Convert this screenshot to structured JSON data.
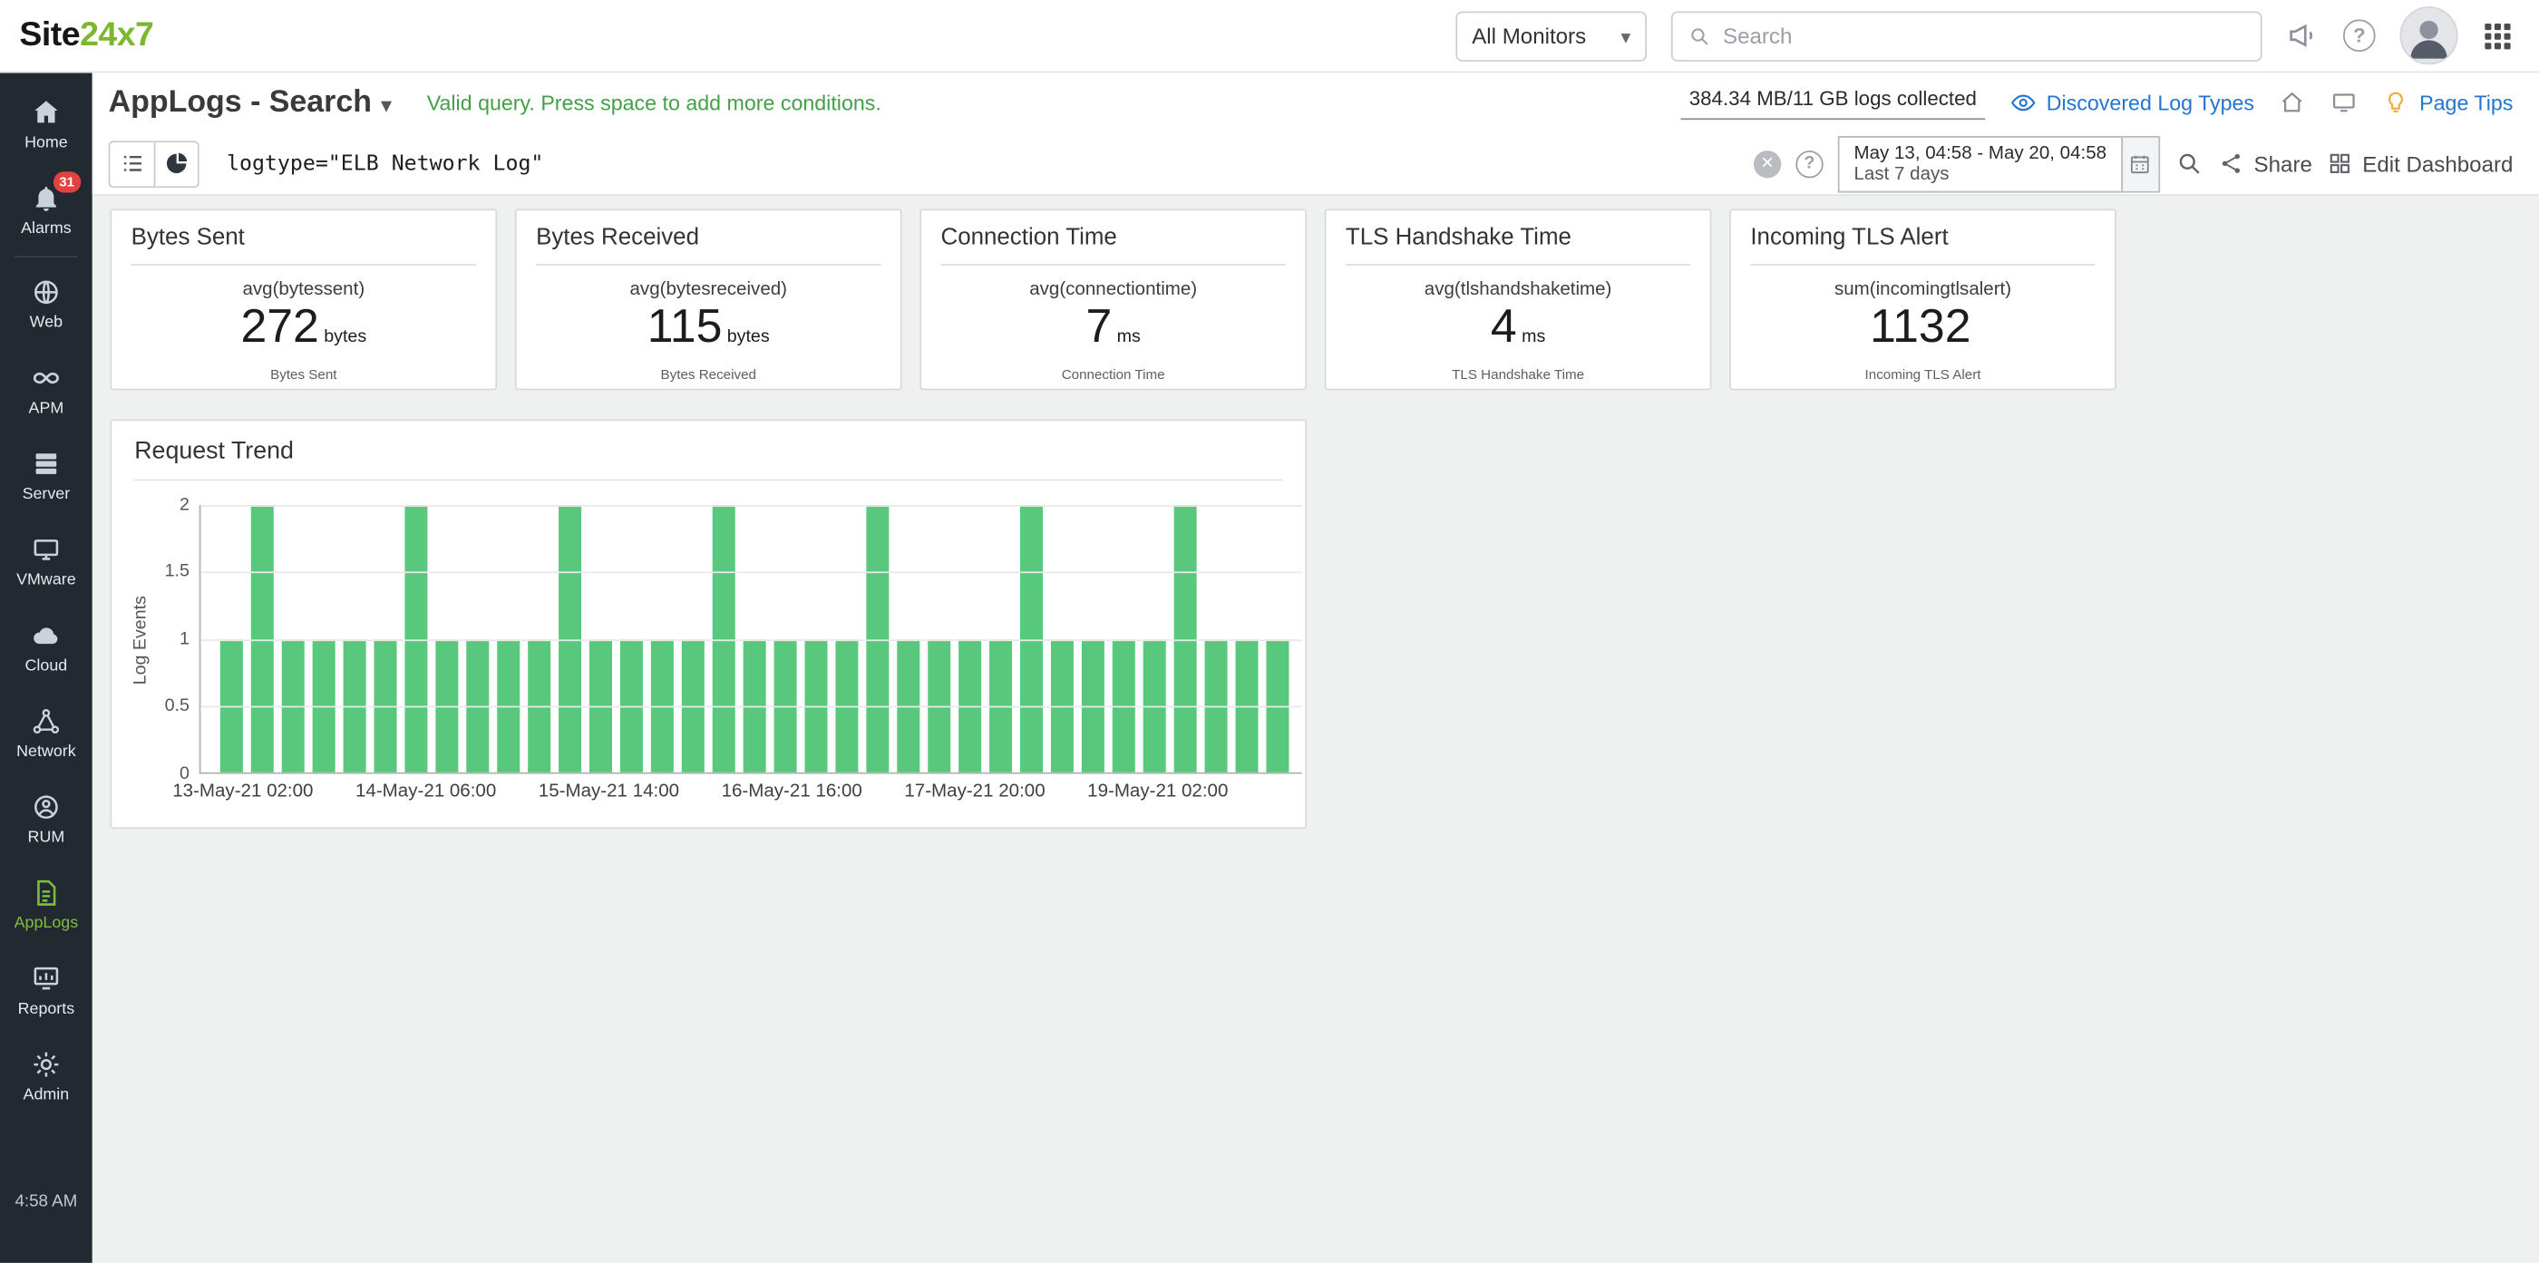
{
  "topbar": {
    "logo_site": "Site",
    "logo_24x7": "24x7",
    "monitor_select": "All Monitors",
    "search_placeholder": "Search"
  },
  "sidebar": {
    "items": [
      {
        "label": "Home"
      },
      {
        "label": "Alarms",
        "badge": "31"
      },
      {
        "label": "Web"
      },
      {
        "label": "APM"
      },
      {
        "label": "Server"
      },
      {
        "label": "VMware"
      },
      {
        "label": "Cloud"
      },
      {
        "label": "Network"
      },
      {
        "label": "RUM"
      },
      {
        "label": "AppLogs",
        "active": true
      },
      {
        "label": "Reports"
      },
      {
        "label": "Admin"
      }
    ],
    "time": "4:58 AM"
  },
  "header": {
    "title": "AppLogs - Search",
    "query_status": "Valid query. Press space to add more conditions.",
    "usage": "384.34 MB/11 GB logs collected",
    "discovered_link": "Discovered Log Types",
    "page_tips": "Page Tips"
  },
  "querybar": {
    "query": "logtype=\"ELB Network Log\"",
    "date_range": "May 13, 04:58 - May 20, 04:58",
    "date_preset": "Last 7 days",
    "share": "Share",
    "edit_dashboard": "Edit Dashboard"
  },
  "cards": [
    {
      "title": "Bytes Sent",
      "agg": "avg(bytessent)",
      "value": "272",
      "unit": "bytes",
      "footer": "Bytes Sent"
    },
    {
      "title": "Bytes Received",
      "agg": "avg(bytesreceived)",
      "value": "115",
      "unit": "bytes",
      "footer": "Bytes Received"
    },
    {
      "title": "Connection Time",
      "agg": "avg(connectiontime)",
      "value": "7",
      "unit": "ms",
      "footer": "Connection Time"
    },
    {
      "title": "TLS Handshake Time",
      "agg": "avg(tlshandshaketime)",
      "value": "4",
      "unit": "ms",
      "footer": "TLS Handshake Time"
    },
    {
      "title": "Incoming TLS Alert",
      "agg": "sum(incomingtlsalert)",
      "value": "1132",
      "unit": "",
      "footer": "Incoming TLS Alert"
    }
  ],
  "chart_data": {
    "type": "bar",
    "title": "Request Trend",
    "ylabel": "Log Events",
    "ylim": [
      0,
      2
    ],
    "yticks": [
      0,
      0.5,
      1,
      1.5,
      2
    ],
    "grid": true,
    "bar_color": "#58c87d",
    "x_tick_labels": [
      "13-May-21 02:00",
      "14-May-21 06:00",
      "15-May-21 14:00",
      "16-May-21 16:00",
      "17-May-21 20:00",
      "19-May-21 02:00"
    ],
    "values": [
      1,
      2,
      1,
      1,
      1,
      1,
      2,
      1,
      1,
      1,
      1,
      2,
      1,
      1,
      1,
      1,
      2,
      1,
      1,
      1,
      1,
      2,
      1,
      1,
      1,
      1,
      2,
      1,
      1,
      1,
      1,
      2,
      1,
      1,
      1
    ]
  },
  "colors": {
    "brand_green": "#7cb82f",
    "active_green": "#7fbe3f",
    "bar_green": "#58c87d",
    "alarm_red": "#e2413f",
    "link_blue": "#2276d2",
    "status_green": "#43a047",
    "sidebar_bg": "#232931"
  },
  "icons": [
    "home-icon",
    "bell-icon",
    "globe-icon",
    "infinity-icon",
    "server-icon",
    "vmware-icon",
    "cloud-icon",
    "network-icon",
    "rum-icon",
    "applogs-doc-icon",
    "reports-icon",
    "gear-icon",
    "search-icon",
    "announcement-icon",
    "help-icon",
    "apps-grid-icon",
    "eye-icon",
    "home-screen-icon",
    "monitor-view-icon",
    "bulb-icon",
    "list-view-icon",
    "pie-view-icon",
    "clear-icon",
    "calendar-icon",
    "share-icon",
    "edit-dashboard-grid-icon",
    "avatar"
  ]
}
